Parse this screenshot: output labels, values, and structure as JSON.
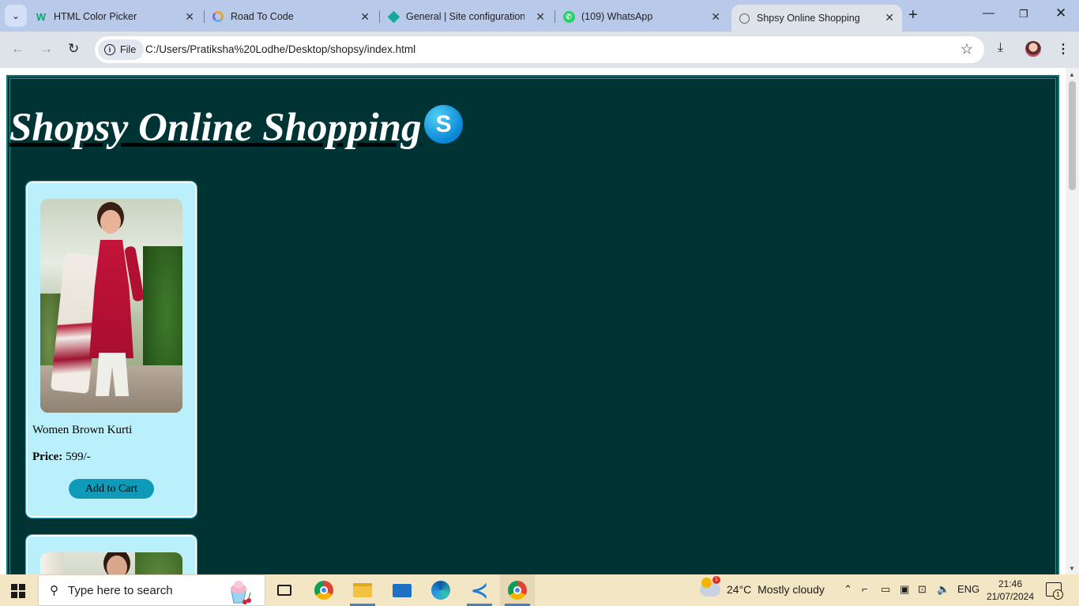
{
  "tabs": [
    {
      "title": "HTML Color Picker",
      "favicon": "w3schools-icon"
    },
    {
      "title": "Road To Code",
      "favicon": "road-icon"
    },
    {
      "title": "General | Site configuration |",
      "favicon": "diamond-icon"
    },
    {
      "title": "(109) WhatsApp",
      "favicon": "whatsapp-icon"
    },
    {
      "title": "Shpsy Online Shopping",
      "favicon": "globe-icon",
      "active": true
    }
  ],
  "toolbar": {
    "chip_label": "File",
    "url": "C:/Users/Pratiksha%20Lodhe/Desktop/shopsy/index.html"
  },
  "page": {
    "heading": "Shopsy Online Shopping ",
    "logo_letter": "S",
    "background": "#003334",
    "products": [
      {
        "name": "Women Brown Kurti",
        "price_label": "Price:",
        "price_value": " 599/-",
        "button_label": "Add to Cart"
      }
    ]
  },
  "taskbar": {
    "search_placeholder": "Type here to search",
    "weather_temp": "24°C",
    "weather_desc": "Mostly cloudy",
    "weather_alert": "1",
    "language": "ENG",
    "time": "21:46",
    "date": "21/07/2024",
    "notification_count": "1"
  }
}
